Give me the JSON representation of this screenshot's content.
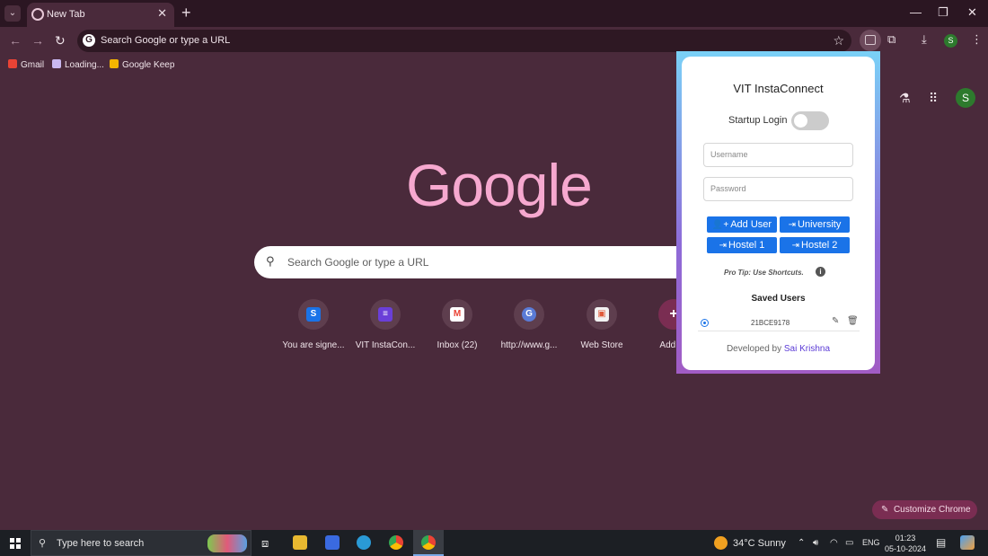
{
  "browser": {
    "tab_title": "New Tab",
    "omnibox_text": "Search Google or type a URL",
    "profile_initial": "S",
    "bookmarks": [
      {
        "label": "Gmail",
        "icon": "gmail-icon",
        "color": "#ea4335"
      },
      {
        "label": "Loading...",
        "icon": "page-icon",
        "color": "#c9b8f0"
      },
      {
        "label": "Google Keep",
        "icon": "keep-icon",
        "color": "#f4b400"
      }
    ]
  },
  "ntp": {
    "logo": "Google",
    "search_placeholder": "Search Google or type a URL",
    "shortcuts": [
      {
        "label": "You are signe...",
        "glyph": "S",
        "color": "#1a73e8"
      },
      {
        "label": "VIT InstaCon...",
        "glyph": "≡",
        "color": "#6a3fd8"
      },
      {
        "label": "Inbox (22)",
        "glyph": "M",
        "color": "#ea4335"
      },
      {
        "label": "http://www.g...",
        "glyph": "G",
        "color": "#5a7bd6"
      },
      {
        "label": "Web Store",
        "glyph": "▣",
        "color": "#e05a3a"
      },
      {
        "label": "Add sh",
        "glyph": "+",
        "color": "#7a2d52"
      }
    ],
    "customize_label": "Customize Chrome"
  },
  "extension": {
    "title": "VIT InstaConnect",
    "startup_label": "Startup Login",
    "startup_enabled": false,
    "username_placeholder": "Username",
    "password_placeholder": "Password",
    "buttons": {
      "add_user": "Add User",
      "university": "University",
      "hostel1": "Hostel 1",
      "hostel2": "Hostel 2"
    },
    "pro_tip": "Pro Tip: Use Shortcuts.",
    "saved_users_heading": "Saved Users",
    "saved_users": [
      {
        "username": "21BCE9178",
        "selected": true
      }
    ],
    "footer_prefix": "Developed by",
    "footer_author": "Sai Krishna",
    "accent": "#1a73e8"
  },
  "taskbar": {
    "search_placeholder": "Type here to search",
    "weather": "34°C  Sunny",
    "language": "ENG",
    "time": "01:23",
    "date": "05-10-2024"
  }
}
